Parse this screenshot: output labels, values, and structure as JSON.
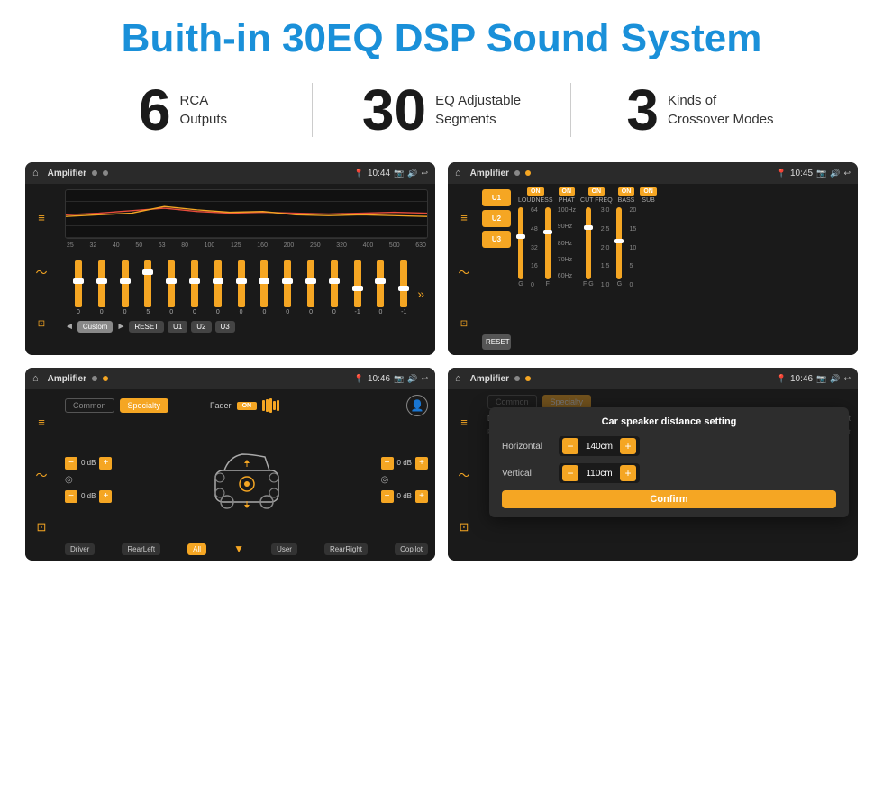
{
  "header": {
    "title": "Buith-in 30EQ DSP Sound System"
  },
  "stats": [
    {
      "number": "6",
      "line1": "RCA",
      "line2": "Outputs"
    },
    {
      "number": "30",
      "line1": "EQ Adjustable",
      "line2": "Segments"
    },
    {
      "number": "3",
      "line1": "Kinds of",
      "line2": "Crossover Modes"
    }
  ],
  "screens": [
    {
      "id": "screen1",
      "topbar": {
        "time": "10:44",
        "title": "Amplifier"
      },
      "type": "eq",
      "freqs": [
        "25",
        "32",
        "40",
        "50",
        "63",
        "80",
        "100",
        "125",
        "160",
        "200",
        "250",
        "320",
        "400",
        "500",
        "630"
      ],
      "values": [
        "0",
        "0",
        "0",
        "5",
        "0",
        "0",
        "0",
        "0",
        "0",
        "0",
        "0",
        "0",
        "-1",
        "0",
        "-1"
      ],
      "buttons": [
        "Custom",
        "RESET",
        "U1",
        "U2",
        "U3"
      ]
    },
    {
      "id": "screen2",
      "topbar": {
        "time": "10:45",
        "title": "Amplifier"
      },
      "type": "amp",
      "toggles": [
        "LOUDNESS",
        "PHAT",
        "CUT FREQ",
        "BASS",
        "SUB"
      ],
      "uButtons": [
        "U1",
        "U2",
        "U3"
      ],
      "resetLabel": "RESET"
    },
    {
      "id": "screen3",
      "topbar": {
        "time": "10:46",
        "title": "Amplifier"
      },
      "type": "speaker",
      "tabs": [
        "Common",
        "Specialty"
      ],
      "faderLabel": "Fader",
      "faderOn": "ON",
      "dbValues": [
        "0 dB",
        "0 dB",
        "0 dB",
        "0 dB"
      ],
      "bottomLabels": [
        "Driver",
        "RearLeft",
        "All",
        "User",
        "RearRight",
        "Copilot"
      ]
    },
    {
      "id": "screen4",
      "topbar": {
        "time": "10:46",
        "title": "Amplifier"
      },
      "type": "dialog",
      "dialog": {
        "title": "Car speaker distance setting",
        "fields": [
          {
            "label": "Horizontal",
            "value": "140cm"
          },
          {
            "label": "Vertical",
            "value": "110cm"
          }
        ],
        "confirmLabel": "Confirm"
      }
    }
  ]
}
